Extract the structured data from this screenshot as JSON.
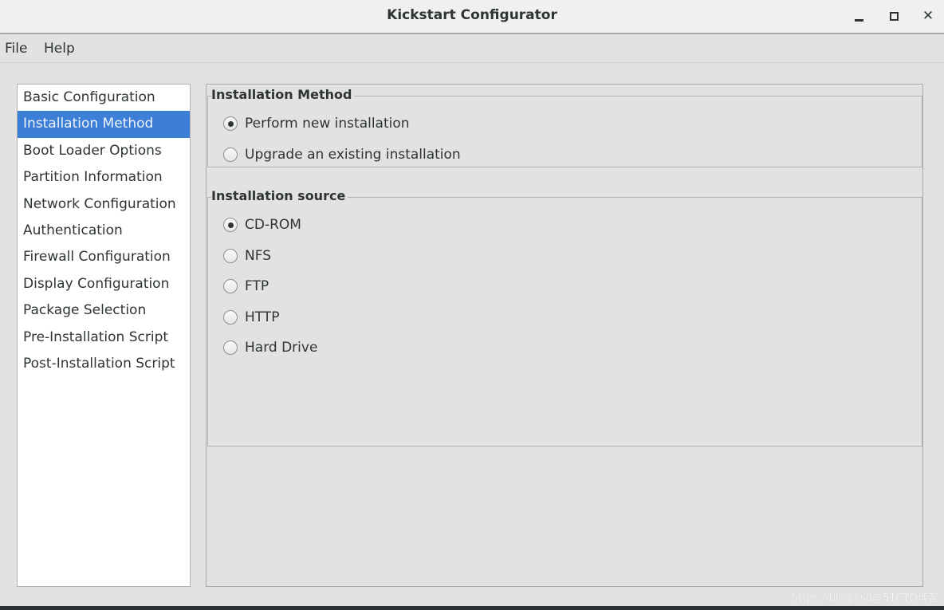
{
  "window": {
    "title": "Kickstart Configurator",
    "controls": {
      "minimize": "minimize-icon",
      "maximize": "maximize-icon",
      "close": "close-icon",
      "close_glyph": "✕"
    }
  },
  "menubar": {
    "items": [
      {
        "label": "File"
      },
      {
        "label": "Help"
      }
    ]
  },
  "sidebar": {
    "selected_index": 1,
    "items": [
      {
        "label": "Basic Configuration"
      },
      {
        "label": "Installation Method"
      },
      {
        "label": "Boot Loader Options"
      },
      {
        "label": "Partition Information"
      },
      {
        "label": "Network Configuration"
      },
      {
        "label": "Authentication"
      },
      {
        "label": "Firewall Configuration"
      },
      {
        "label": "Display Configuration"
      },
      {
        "label": "Package Selection"
      },
      {
        "label": "Pre-Installation Script"
      },
      {
        "label": "Post-Installation Script"
      }
    ]
  },
  "installation_method": {
    "title": "Installation Method",
    "options": [
      {
        "label": "Perform new installation",
        "checked": true
      },
      {
        "label": "Upgrade an existing installation",
        "checked": false
      }
    ]
  },
  "installation_source": {
    "title": "Installation source",
    "options": [
      {
        "label": "CD-ROM",
        "checked": true
      },
      {
        "label": "NFS",
        "checked": false
      },
      {
        "label": "FTP",
        "checked": false
      },
      {
        "label": "HTTP",
        "checked": false
      },
      {
        "label": "Hard Drive",
        "checked": false
      }
    ]
  },
  "colors": {
    "selection": "#3d7ed6",
    "window_bg": "#e2e2e0",
    "titlebar_bg": "#f0f0ef"
  },
  "watermark": "https://blog.csd@51CTO博客"
}
